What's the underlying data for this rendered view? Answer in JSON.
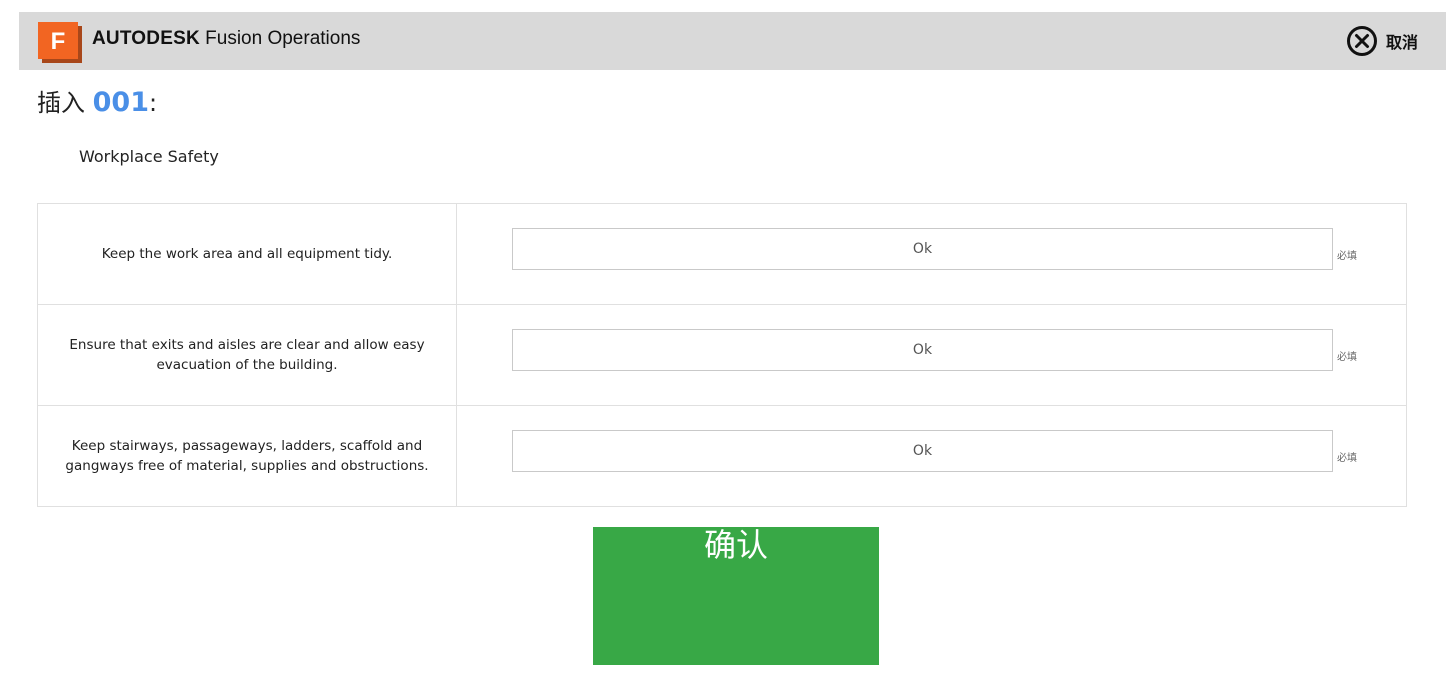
{
  "header": {
    "brand": "AUTODESK",
    "product": "Fusion Operations",
    "logo_letter": "F",
    "logo_color": "#f26522",
    "cancel_label": "取消",
    "background": "#d9d9d9"
  },
  "form": {
    "title_prefix": "插入",
    "title_code": "001",
    "title_suffix": ":",
    "section_title": "Workplace Safety"
  },
  "checklist": {
    "items": [
      {
        "label": "Keep the work area and all equipment tidy.",
        "value": "Ok",
        "required_label": "必填"
      },
      {
        "label": "Ensure that exits and aisles are clear and allow easy evacuation of the building.",
        "value": "Ok",
        "required_label": "必填"
      },
      {
        "label": "Keep stairways, passageways, ladders, scaffold and gangways free of material, supplies and obstructions.",
        "value": "Ok",
        "required_label": "必填"
      }
    ]
  },
  "actions": {
    "confirm_label": "确认",
    "confirm_color": "#38a846"
  },
  "icons": {
    "logo": "fusion-logo-icon",
    "cancel": "close-circle-icon"
  }
}
